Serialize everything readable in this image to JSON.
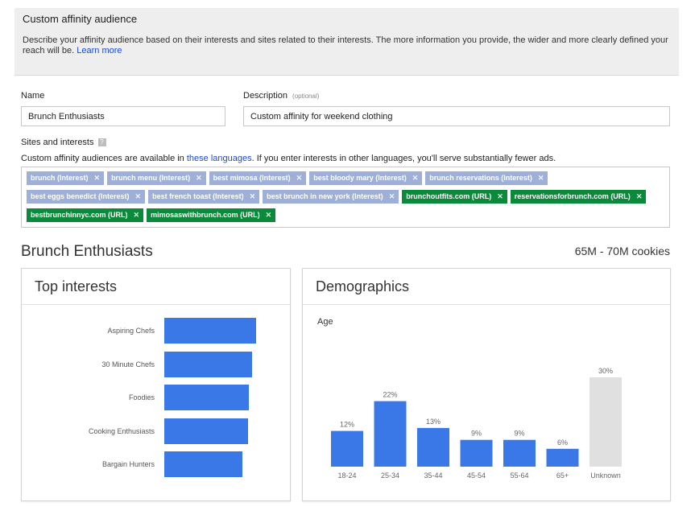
{
  "header": {
    "title": "Custom affinity audience",
    "description": "Describe your affinity audience based on their interests and sites related to their interests. The more information you provide, the wider and more clearly defined your reach will be.",
    "learn_more": "Learn more"
  },
  "form": {
    "name_label": "Name",
    "name_value": "Brunch Enthusiasts",
    "description_label": "Description",
    "description_optional": "(optional)",
    "description_value": "Custom affinity for weekend clothing",
    "sites_label": "Sites and interests",
    "help_icon": "?",
    "note_prefix": "Custom affinity audiences are available in",
    "note_link": "these languages",
    "note_suffix": ". If you enter interests in other languages, you'll serve substantially fewer ads.",
    "remove_icon": "✕",
    "tags": [
      {
        "text": "brunch (Interest)",
        "kind": "interest"
      },
      {
        "text": "brunch menu (Interest)",
        "kind": "interest"
      },
      {
        "text": "best mimosa (Interest)",
        "kind": "interest"
      },
      {
        "text": "best bloody mary (Interest)",
        "kind": "interest"
      },
      {
        "text": "brunch reservations (Interest)",
        "kind": "interest"
      },
      {
        "text": "best eggs benedict (Interest)",
        "kind": "interest"
      },
      {
        "text": "best french toast (Interest)",
        "kind": "interest"
      },
      {
        "text": "best brunch in new york (Interest)",
        "kind": "interest"
      },
      {
        "text": "brunchoutfits.com (URL)",
        "kind": "url"
      },
      {
        "text": "reservationsforbrunch.com (URL)",
        "kind": "url"
      },
      {
        "text": "bestbrunchinnyc.com (URL)",
        "kind": "url"
      },
      {
        "text": "mimosaswithbrunch.com (URL)",
        "kind": "url"
      }
    ]
  },
  "audience": {
    "title": "Brunch Enthusiasts",
    "cookies": "65M - 70M cookies"
  },
  "top_interests": {
    "title": "Top interests",
    "items": [
      "Aspiring Chefs",
      "30 Minute Chefs",
      "Foodies",
      "Cooking Enthusiasts",
      "Bargain Hunters"
    ],
    "values": [
      100,
      96,
      92,
      91,
      85
    ]
  },
  "demographics": {
    "title": "Demographics",
    "age_label": "Age"
  },
  "chart_data": {
    "type": "bar",
    "categories": [
      "18-24",
      "25-34",
      "35-44",
      "45-54",
      "55-64",
      "65+",
      "Unknown"
    ],
    "values": [
      12,
      22,
      13,
      9,
      9,
      6,
      30
    ],
    "labels": [
      "12%",
      "22%",
      "13%",
      "9%",
      "9%",
      "6%",
      "30%"
    ],
    "ylim": [
      0,
      30
    ],
    "colors": {
      "known": "#3b78e7",
      "unknown": "#e0e0e0"
    }
  }
}
